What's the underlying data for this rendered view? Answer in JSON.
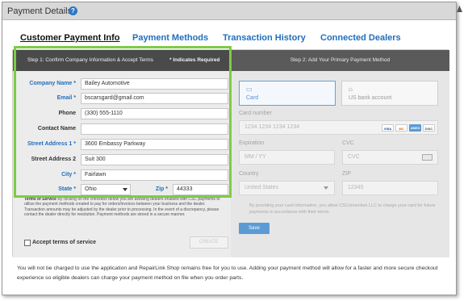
{
  "window": {
    "title": "Payment Details"
  },
  "tabs": [
    {
      "label": "Customer Payment Info",
      "active": true
    },
    {
      "label": "Payment Methods",
      "active": false
    },
    {
      "label": "Transaction History",
      "active": false
    },
    {
      "label": "Connected Dealers",
      "active": false
    }
  ],
  "step1": {
    "title": "Step 1: Confirm Company Information & Accept Terms",
    "required_note": "* Indicates Required Field",
    "fields": [
      {
        "label": "Company Name *",
        "value": "Bailey Automotive"
      },
      {
        "label": "Email *",
        "value": "bscarsgard@gmail.com"
      },
      {
        "label": "Phone",
        "value": "(330) 555-1110"
      },
      {
        "label": "Contact Name",
        "value": ""
      },
      {
        "label": "Street Address 1 *",
        "value": "3600 Embassy Parkway"
      },
      {
        "label": "Street Address 2",
        "value": "Suit 300"
      },
      {
        "label": "City *",
        "value": "Fairlawn"
      }
    ],
    "state": {
      "label": "State *",
      "value": "Ohio"
    },
    "zip": {
      "label": "Zip *",
      "value": "44333"
    },
    "terms_heading": "Terms of Service",
    "terms_text": "By clicking on the checkbox below you are allowing dealers enabled with CSC payments to utilize the payment methods created to pay for orders/invoices between your business and the dealer. Transaction amounts may be adjusted by the dealer prior to processing. In the event of a discrepancy, please contact the dealer directly for resolution. Payment methods are stored in a secure manner.",
    "accept_label": "Accept terms of service",
    "create_label": "CREATE"
  },
  "step2": {
    "title": "Step 2: Add Your Primary Payment Method",
    "methods": [
      {
        "label": "Card",
        "icon": "card-icon",
        "selected": true
      },
      {
        "label": "US bank account",
        "icon": "bank-icon",
        "selected": false
      }
    ],
    "card_number_label": "Card number",
    "card_number_placeholder": "1234 1234 1234 1234",
    "brands": [
      "VISA",
      "MC",
      "AMEX",
      "DISC"
    ],
    "expiration_label": "Expiration",
    "expiration_placeholder": "MM / YY",
    "cvc_label": "CVC",
    "cvc_placeholder": "CVC",
    "country_label": "Country",
    "country_value": "United States",
    "zip_label": "ZIP",
    "zip_placeholder": "12345",
    "disclaimer": "By providing your card information, you allow CSConnection LLC to charge your card for future payments in accordance with their terms.",
    "save_label": "Save"
  },
  "footer": "You will not be charged to use the application and RepairLink Shop remains free for you to use. Adding your payment method will allow for a faster and more secure checkout experience so eligible dealers can charge your payment method on file when you order parts.",
  "colors": {
    "accent": "#1f6fbd",
    "highlight": "#7fcb45",
    "save": "#5b9bd5"
  }
}
